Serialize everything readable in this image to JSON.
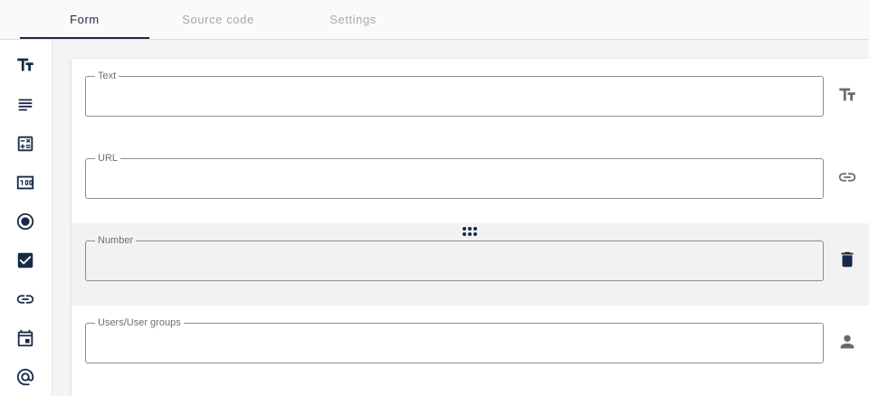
{
  "tabs": [
    {
      "label": "Form",
      "active": true
    },
    {
      "label": "Source code",
      "active": false
    },
    {
      "label": "Settings",
      "active": false
    }
  ],
  "sidebar": {
    "items": [
      {
        "icon": "text-fields-icon"
      },
      {
        "icon": "subject-icon"
      },
      {
        "icon": "calculate-icon"
      },
      {
        "icon": "number-icon"
      },
      {
        "icon": "radio-button-icon"
      },
      {
        "icon": "checkbox-icon"
      },
      {
        "icon": "link-icon"
      },
      {
        "icon": "calendar-icon"
      },
      {
        "icon": "at-sign-icon"
      }
    ]
  },
  "form": {
    "fields": [
      {
        "label": "Text",
        "value": "",
        "type_icon": "text-fields-icon"
      },
      {
        "label": "URL",
        "value": "",
        "type_icon": "link-icon"
      },
      {
        "label": "Number",
        "value": "",
        "type_icon": "delete-icon",
        "selected": true
      },
      {
        "label": "Users/User groups",
        "value": "",
        "type_icon": "person-icon"
      }
    ]
  },
  "colors": {
    "primary": "#17294a",
    "inactive_tab": "#a9a9a9",
    "selected_row": "#f2f2f2"
  }
}
